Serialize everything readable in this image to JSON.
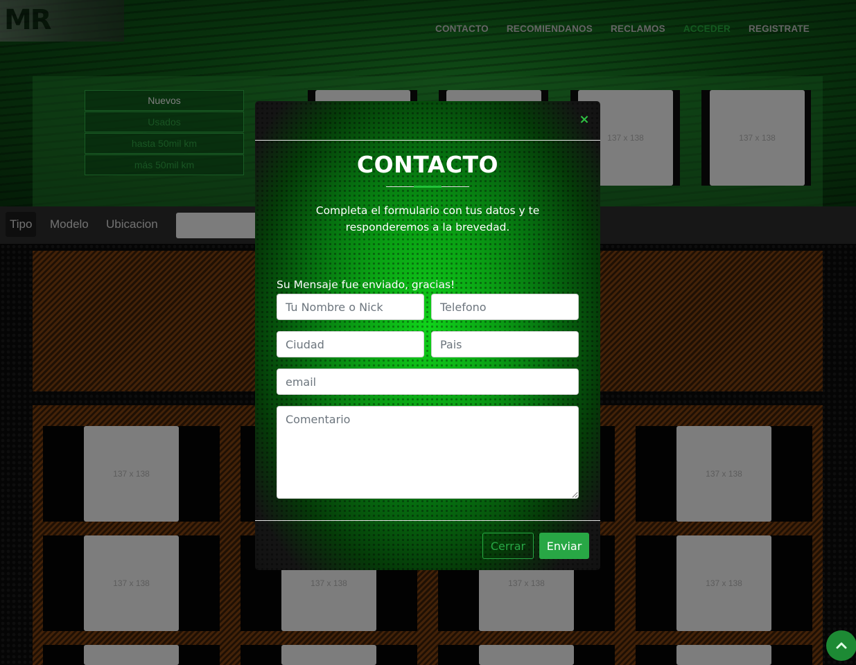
{
  "logo": {
    "text": "MR"
  },
  "nav": {
    "items": [
      "CONTACTO",
      "RECOMIENDANOS",
      "RECLAMOS",
      "ACCEDER",
      "REGISTRATE"
    ],
    "active": "ACCEDER"
  },
  "filters": [
    "Nuevos",
    "Usados",
    "hasta 50mil km",
    "más 50mil km"
  ],
  "tabs": [
    "Tipo",
    "Modelo",
    "Ubicacion"
  ],
  "placeholder_image": {
    "label": "137 x 138"
  },
  "modal": {
    "title": "CONTACTO",
    "description": "Completa el formulario con tus datos y te responderemos a la brevedad.",
    "success_message": "Su Mensaje fue enviado, gracias!",
    "fields": {
      "name": {
        "placeholder": "Tu Nombre o Nick"
      },
      "phone": {
        "placeholder": "Telefono"
      },
      "city": {
        "placeholder": "Ciudad"
      },
      "country": {
        "placeholder": "Pais"
      },
      "email": {
        "placeholder": "email"
      },
      "comment": {
        "placeholder": "Comentario"
      }
    },
    "close_label": "Cerrar",
    "send_label": "Enviar",
    "close_icon": "×"
  },
  "scroll_top_icon": "chevron-up-icon",
  "colors": {
    "accent_green": "#28a745",
    "nav_active": "#26a23b",
    "stripe_orange": "#7a3e10"
  }
}
